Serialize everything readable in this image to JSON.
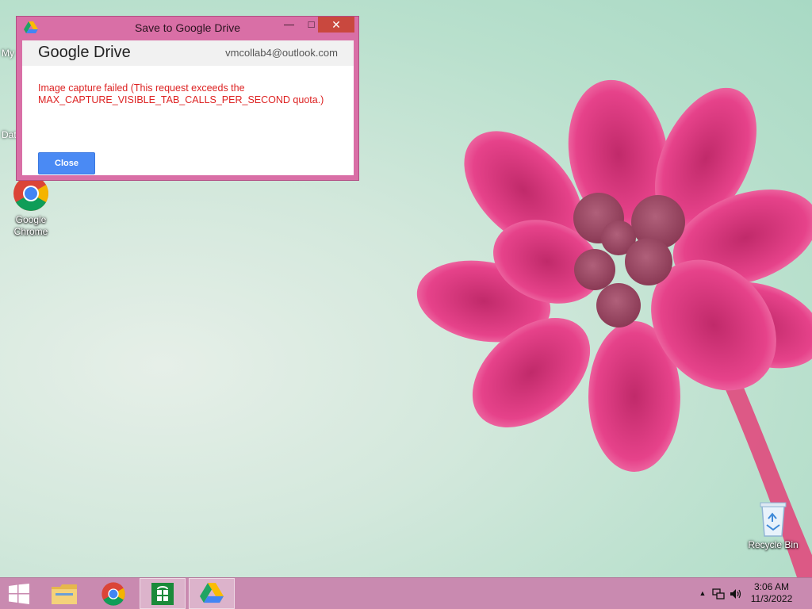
{
  "desktop": {
    "icons": [
      {
        "label": "Google Chrome"
      },
      {
        "label": "Recycle Bin"
      }
    ],
    "partial_labels": [
      "My",
      "Dat"
    ]
  },
  "dialog": {
    "title": "Save to Google Drive",
    "brand": "Google Drive",
    "account": "vmcollab4@outlook.com",
    "error_line1": "Image capture failed (This request exceeds the",
    "error_line2": "MAX_CAPTURE_VISIBLE_TAB_CALLS_PER_SECOND quota.)",
    "close_label": "Close",
    "error_color": "#dd2222",
    "button_color": "#4a8af4"
  },
  "taskbar": {
    "items": [
      "start-button",
      "file-explorer",
      "google-chrome",
      "windows-store",
      "google-drive"
    ],
    "active_item": "google-drive",
    "time": "3:06 AM",
    "date": "11/3/2022"
  }
}
